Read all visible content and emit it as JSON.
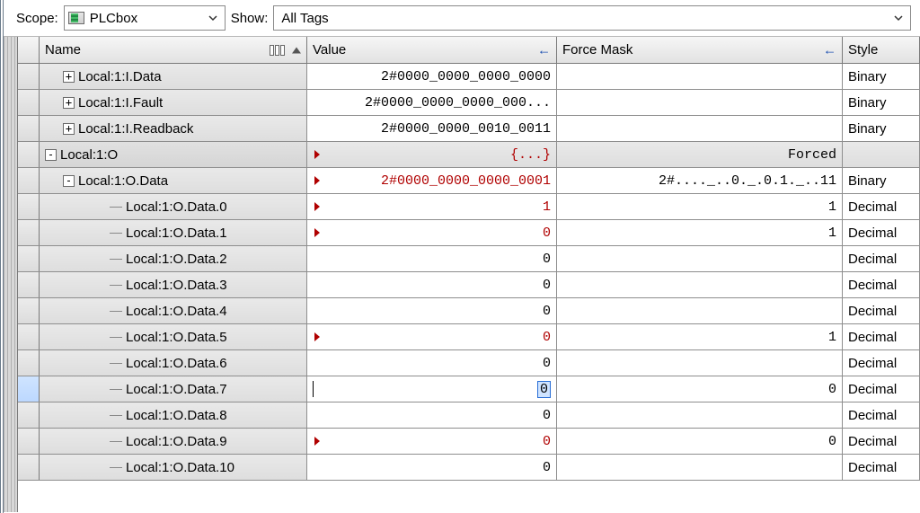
{
  "filter": {
    "scope_label": "Scope:",
    "scope_value": "PLCbox",
    "show_label": "Show:",
    "show_value": "All Tags"
  },
  "columns": {
    "name": "Name",
    "value": "Value",
    "force": "Force Mask",
    "style": "Style"
  },
  "rows": [
    {
      "indent": 1,
      "expander": "+",
      "name": "Local:1:I.Data",
      "value": "2#0000_0000_0000_0000",
      "force": "",
      "style": "Binary",
      "shade": false,
      "val_red": false,
      "marker": false
    },
    {
      "indent": 1,
      "expander": "+",
      "name": "Local:1:I.Fault",
      "value": "2#0000_0000_0000_000...",
      "force": "",
      "style": "Binary",
      "shade": false,
      "val_red": false,
      "marker": false
    },
    {
      "indent": 1,
      "expander": "+",
      "name": "Local:1:I.Readback",
      "value": "2#0000_0000_0010_0011",
      "force": "",
      "style": "Binary",
      "shade": false,
      "val_red": false,
      "marker": false
    },
    {
      "indent": 0,
      "expander": "-",
      "name": "Local:1:O",
      "value": "{...}",
      "force": "Forced",
      "style": "",
      "shade": true,
      "val_red": true,
      "marker": true
    },
    {
      "indent": 1,
      "expander": "-",
      "name": "Local:1:O.Data",
      "value": "2#0000_0000_0000_0001",
      "force": "2#...._..0._.0.1._..11",
      "style": "Binary",
      "shade": false,
      "val_red": true,
      "marker": true
    },
    {
      "indent": 2,
      "expander": "",
      "name": "Local:1:O.Data.0",
      "value": "1",
      "force": "1",
      "style": "Decimal",
      "shade": false,
      "val_red": true,
      "marker": true
    },
    {
      "indent": 2,
      "expander": "",
      "name": "Local:1:O.Data.1",
      "value": "0",
      "force": "1",
      "style": "Decimal",
      "shade": false,
      "val_red": true,
      "marker": true
    },
    {
      "indent": 2,
      "expander": "",
      "name": "Local:1:O.Data.2",
      "value": "0",
      "force": "",
      "style": "Decimal",
      "shade": false,
      "val_red": false,
      "marker": false
    },
    {
      "indent": 2,
      "expander": "",
      "name": "Local:1:O.Data.3",
      "value": "0",
      "force": "",
      "style": "Decimal",
      "shade": false,
      "val_red": false,
      "marker": false
    },
    {
      "indent": 2,
      "expander": "",
      "name": "Local:1:O.Data.4",
      "value": "0",
      "force": "",
      "style": "Decimal",
      "shade": false,
      "val_red": false,
      "marker": false
    },
    {
      "indent": 2,
      "expander": "",
      "name": "Local:1:O.Data.5",
      "value": "0",
      "force": "1",
      "style": "Decimal",
      "shade": false,
      "val_red": true,
      "marker": true
    },
    {
      "indent": 2,
      "expander": "",
      "name": "Local:1:O.Data.6",
      "value": "0",
      "force": "",
      "style": "Decimal",
      "shade": false,
      "val_red": false,
      "marker": false
    },
    {
      "indent": 2,
      "expander": "",
      "name": "Local:1:O.Data.7",
      "value": "0",
      "force": "0",
      "style": "Decimal",
      "shade": false,
      "val_red": false,
      "marker": false,
      "editing": true
    },
    {
      "indent": 2,
      "expander": "",
      "name": "Local:1:O.Data.8",
      "value": "0",
      "force": "",
      "style": "Decimal",
      "shade": false,
      "val_red": false,
      "marker": false
    },
    {
      "indent": 2,
      "expander": "",
      "name": "Local:1:O.Data.9",
      "value": "0",
      "force": "0",
      "style": "Decimal",
      "shade": false,
      "val_red": true,
      "marker": true
    },
    {
      "indent": 2,
      "expander": "",
      "name": "Local:1:O.Data.10",
      "value": "0",
      "force": "",
      "style": "Decimal",
      "shade": false,
      "val_red": false,
      "marker": false
    }
  ]
}
